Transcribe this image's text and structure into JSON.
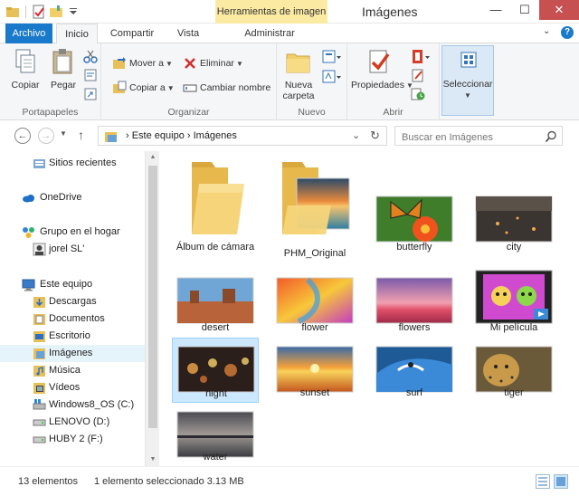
{
  "titlebar": {
    "context_tab": "Herramientas de imagen",
    "title": "Imágenes",
    "minimize": "—",
    "maximize": "☐",
    "close": "✕"
  },
  "tabs": {
    "file": "Archivo",
    "home": "Inicio",
    "share": "Compartir",
    "view": "Vista",
    "manage": "Administrar",
    "collapse": "⌄",
    "help": "?"
  },
  "ribbon": {
    "clipboard": {
      "name": "Portapapeles",
      "copy": "Copiar",
      "paste": "Pegar"
    },
    "organize": {
      "name": "Organizar",
      "move_to": "Mover a",
      "copy_to": "Copiar a",
      "delete": "Eliminar",
      "rename": "Cambiar nombre"
    },
    "new": {
      "name": "Nuevo",
      "new_folder_line1": "Nueva",
      "new_folder_line2": "carpeta"
    },
    "open": {
      "name": "Abrir",
      "properties": "Propiedades"
    },
    "select": {
      "label": "Seleccionar"
    }
  },
  "address": {
    "back": "←",
    "forward": "→",
    "up": "↑",
    "crumbs": "›  Este equipo  ›  Imágenes",
    "dropdown": "⌄",
    "refresh": "↻",
    "search_placeholder": "Buscar en Imágenes"
  },
  "navpane": {
    "items": [
      {
        "label": "Sitios recientes"
      },
      {
        "label": "OneDrive"
      },
      {
        "label": "Grupo en el hogar"
      },
      {
        "label": "jorel SL'"
      },
      {
        "label": "Este equipo"
      },
      {
        "label": "Descargas"
      },
      {
        "label": "Documentos"
      },
      {
        "label": "Escritorio"
      },
      {
        "label": "Imágenes"
      },
      {
        "label": "Música"
      },
      {
        "label": "Vídeos"
      },
      {
        "label": "Windows8_OS (C:)"
      },
      {
        "label": "LENOVO (D:)"
      },
      {
        "label": "HUBY 2 (F:)"
      }
    ]
  },
  "files": [
    {
      "name": "Álbum de cámara",
      "kind": "folder"
    },
    {
      "name": "PHM_Original",
      "kind": "folder-photo"
    },
    {
      "name": "butterfly",
      "kind": "photo"
    },
    {
      "name": "city",
      "kind": "photo"
    },
    {
      "name": "desert",
      "kind": "photo"
    },
    {
      "name": "flower",
      "kind": "photo"
    },
    {
      "name": "flowers",
      "kind": "photo"
    },
    {
      "name": "Mi película",
      "kind": "video"
    },
    {
      "name": "night",
      "kind": "photo"
    },
    {
      "name": "sunset",
      "kind": "photo"
    },
    {
      "name": "surf",
      "kind": "photo"
    },
    {
      "name": "tiger",
      "kind": "photo"
    },
    {
      "name": "water",
      "kind": "photo"
    }
  ],
  "status": {
    "count": "13 elementos",
    "selection": "1 elemento seleccionado  3.13 MB"
  },
  "colors": {
    "file_tab": "#1979ca",
    "context_tab": "#fbeaa2",
    "selection": "#cce8ff",
    "close_button": "#c75050"
  }
}
